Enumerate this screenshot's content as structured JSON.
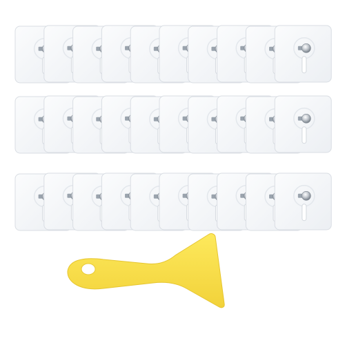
{
  "product": {
    "hook_rows": 3,
    "hooks_per_row": 10,
    "hook_total": 30,
    "scraper_count": 1
  },
  "colors": {
    "background": "#ffffff",
    "hook_fill": "#f6f7f9",
    "hook_edge": "#d9dde3",
    "screw_metal": "#9aa3ad",
    "scraper_yellow": "#fbe34a"
  }
}
